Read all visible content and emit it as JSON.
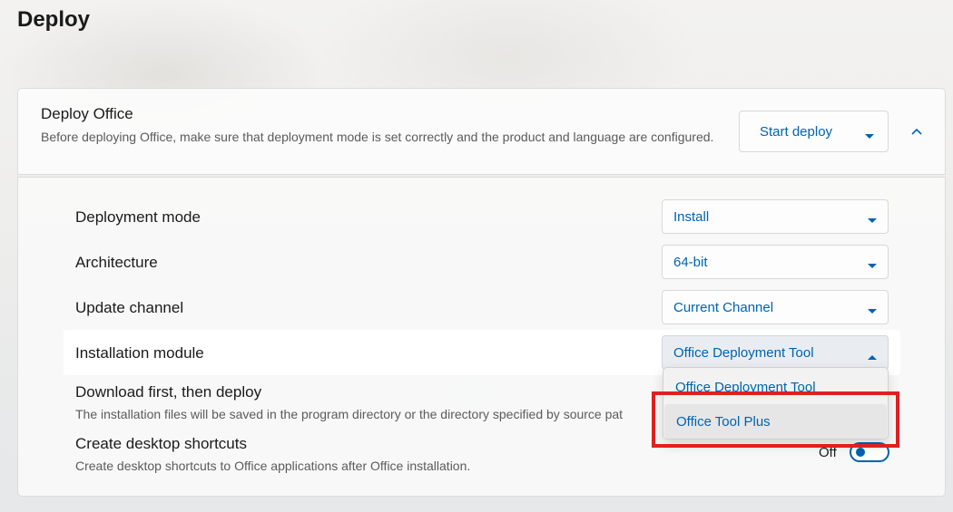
{
  "page": {
    "title": "Deploy"
  },
  "deploy_office": {
    "title": "Deploy Office",
    "description": "Before deploying Office, make sure that deployment mode is set correctly and the product and language are configured.",
    "start_button": "Start deploy"
  },
  "settings": {
    "deployment_mode": {
      "label": "Deployment mode",
      "value": "Install"
    },
    "architecture": {
      "label": "Architecture",
      "value": "64-bit"
    },
    "update_channel": {
      "label": "Update channel",
      "value": "Current Channel"
    },
    "installation_module": {
      "label": "Installation module",
      "value": "Office Deployment Tool",
      "options": [
        "Office Deployment Tool",
        "Office Tool Plus"
      ]
    },
    "download_first": {
      "label": "Download first, then deploy",
      "description": "The installation files will be saved in the program directory or the directory specified by source pat"
    },
    "desktop_shortcuts": {
      "label": "Create desktop shortcuts",
      "description": "Create desktop shortcuts to Office applications after Office installation.",
      "toggle_state": "Off"
    }
  },
  "colors": {
    "accent": "#0063b1",
    "highlight_box": "#e02020"
  },
  "icons": {
    "dropdown": "chevron-down-icon",
    "collapse": "chevron-up-icon",
    "open_dropdown": "chevron-up-icon"
  }
}
